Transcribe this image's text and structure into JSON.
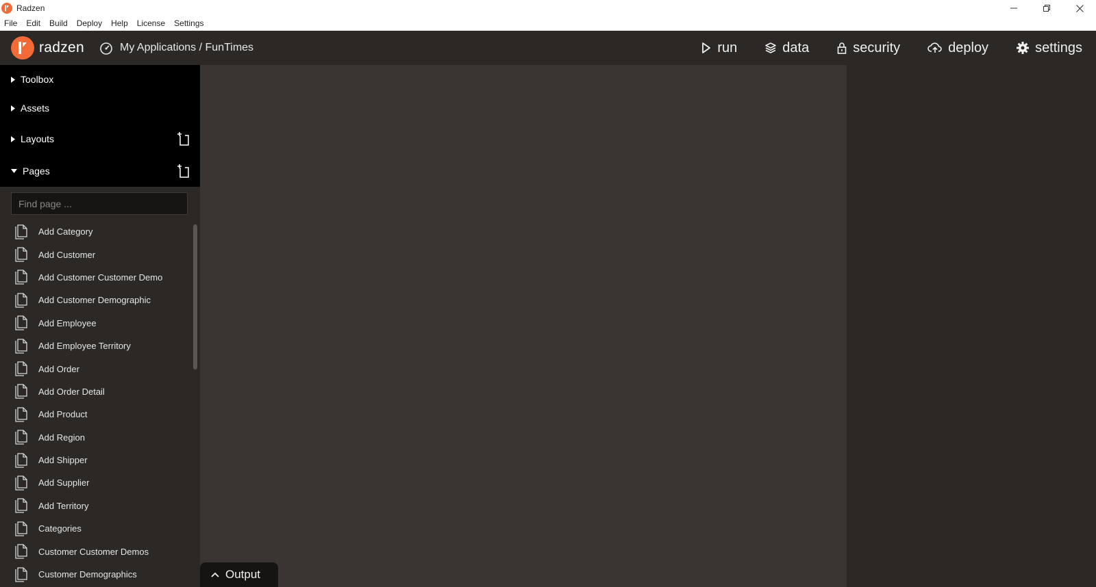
{
  "window": {
    "title": "Radzen",
    "controls": [
      "minimize-icon",
      "restore-icon",
      "close-icon"
    ]
  },
  "menu": [
    "File",
    "Edit",
    "Build",
    "Deploy",
    "Help",
    "License",
    "Settings"
  ],
  "header": {
    "logo_text": "radzen",
    "breadcrumb": "My Applications / FunTimes",
    "nav": [
      {
        "label": "run",
        "icon": "play-icon"
      },
      {
        "label": "data",
        "icon": "layers-icon"
      },
      {
        "label": "security",
        "icon": "lock-icon"
      },
      {
        "label": "deploy",
        "icon": "cloud-upload-icon"
      },
      {
        "label": "settings",
        "icon": "gear-icon"
      }
    ]
  },
  "sidebar": {
    "sections": [
      {
        "label": "Toolbox",
        "expanded": false,
        "has_add": false
      },
      {
        "label": "Assets",
        "expanded": false,
        "has_add": false
      },
      {
        "label": "Layouts",
        "expanded": false,
        "has_add": true
      },
      {
        "label": "Pages",
        "expanded": true,
        "has_add": true
      }
    ],
    "search_placeholder": "Find page ...",
    "pages": [
      "Add Category",
      "Add Customer",
      "Add Customer Customer Demo",
      "Add Customer Demographic",
      "Add Employee",
      "Add Employee Territory",
      "Add Order",
      "Add Order Detail",
      "Add Product",
      "Add Region",
      "Add Shipper",
      "Add Supplier",
      "Add Territory",
      "Categories",
      "Customer Customer Demos",
      "Customer Demographics"
    ]
  },
  "output_tab": {
    "label": "Output"
  },
  "colors": {
    "accent": "#f26a36",
    "header_bg": "#2b2826",
    "section_bg": "#000000",
    "canvas_bg": "#3a3533"
  }
}
